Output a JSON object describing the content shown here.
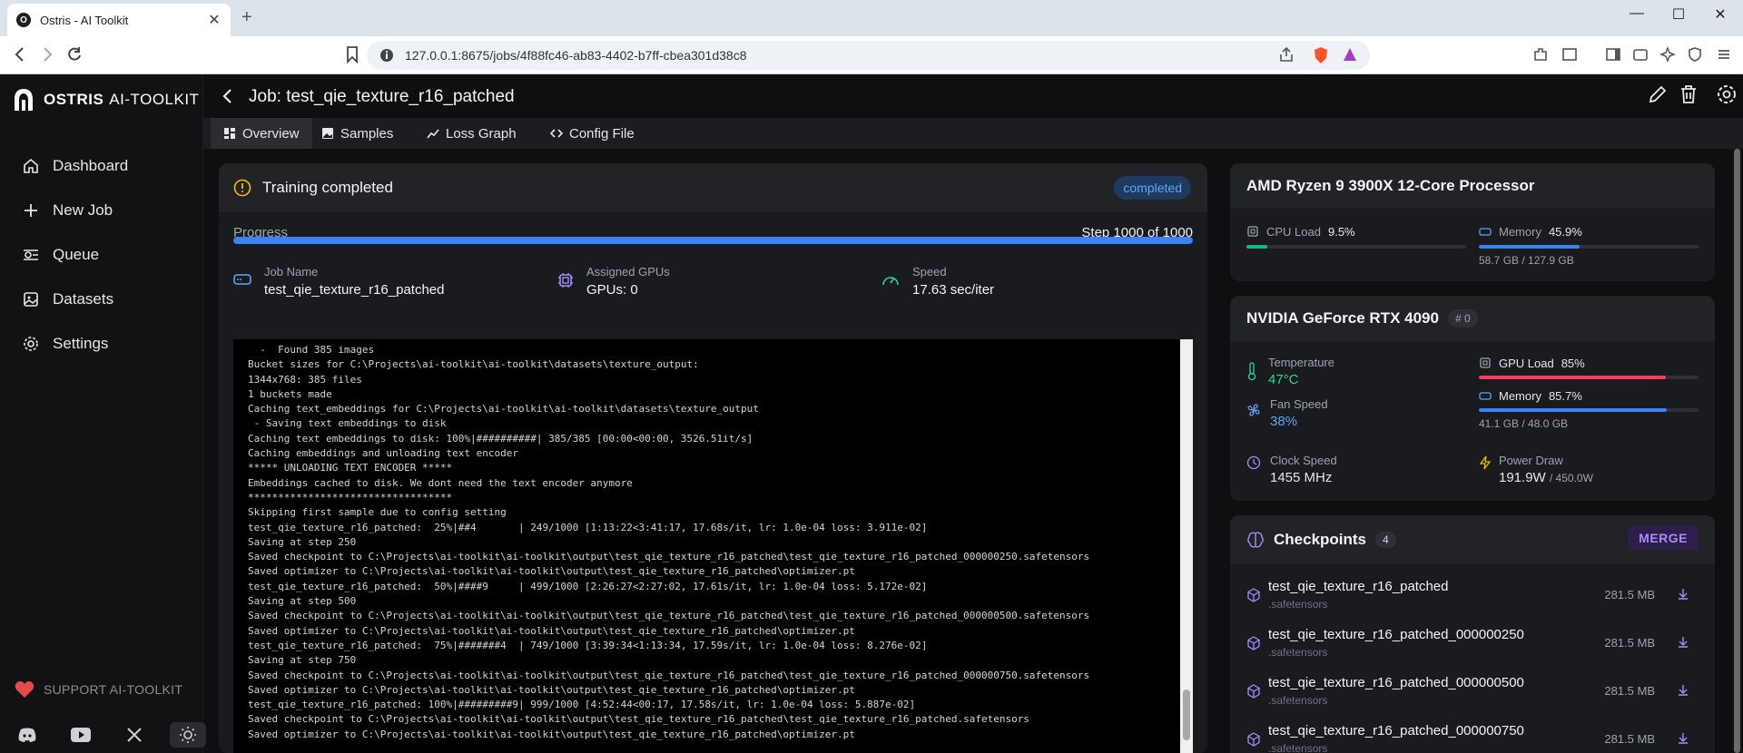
{
  "browser": {
    "tab_title": "Ostris - AI Toolkit",
    "url": "127.0.0.1:8675/jobs/4f88fc46-ab83-4402-b7ff-cbea301d38c8"
  },
  "brand": {
    "name": "OSTRIS",
    "product": "AI-TOOLKIT"
  },
  "sidebar": {
    "items": [
      {
        "label": "Dashboard",
        "icon": "home-icon"
      },
      {
        "label": "New Job",
        "icon": "plus-icon"
      },
      {
        "label": "Queue",
        "icon": "queue-icon"
      },
      {
        "label": "Datasets",
        "icon": "image-icon"
      },
      {
        "label": "Settings",
        "icon": "gear-icon"
      }
    ],
    "support_label": "SUPPORT AI-TOOLKIT"
  },
  "header": {
    "title": "Job: test_qie_texture_r16_patched"
  },
  "tabs": [
    {
      "label": "Overview",
      "active": true
    },
    {
      "label": "Samples",
      "active": false
    },
    {
      "label": "Loss Graph",
      "active": false
    },
    {
      "label": "Config File",
      "active": false
    }
  ],
  "job": {
    "status_title": "Training completed",
    "status_badge": "completed",
    "progress_label": "Progress",
    "progress_step": "Step 1000 of 1000",
    "progress_fraction": 1.0,
    "stats": [
      {
        "label": "Job Name",
        "value": "test_qie_texture_r16_patched"
      },
      {
        "label": "Assigned GPUs",
        "value": "GPUs: 0"
      },
      {
        "label": "Speed",
        "value": "17.63 sec/iter"
      }
    ],
    "log_lines": [
      "  -  Found 385 images",
      "Bucket sizes for C:\\Projects\\ai-toolkit\\ai-toolkit\\datasets\\texture_output:",
      "1344x768: 385 files",
      "1 buckets made",
      "Caching text_embeddings for C:\\Projects\\ai-toolkit\\ai-toolkit\\datasets\\texture_output",
      " - Saving text embeddings to disk",
      "Caching text embeddings to disk: 100%|##########| 385/385 [00:00<00:00, 3526.51it/s]",
      "Caching embeddings and unloading text encoder",
      "***** UNLOADING TEXT ENCODER *****",
      "Embeddings cached to disk. We dont need the text encoder anymore",
      "**********************************",
      "Skipping first sample due to config setting",
      "test_qie_texture_r16_patched:  25%|##4       | 249/1000 [1:13:22<3:41:17, 17.68s/it, lr: 1.0e-04 loss: 3.911e-02]",
      "Saving at step 250",
      "Saved checkpoint to C:\\Projects\\ai-toolkit\\ai-toolkit\\output\\test_qie_texture_r16_patched\\test_qie_texture_r16_patched_000000250.safetensors",
      "Saved optimizer to C:\\Projects\\ai-toolkit\\ai-toolkit\\output\\test_qie_texture_r16_patched\\optimizer.pt",
      "test_qie_texture_r16_patched:  50%|####9     | 499/1000 [2:26:27<2:27:02, 17.61s/it, lr: 1.0e-04 loss: 5.172e-02]",
      "Saving at step 500",
      "Saved checkpoint to C:\\Projects\\ai-toolkit\\ai-toolkit\\output\\test_qie_texture_r16_patched\\test_qie_texture_r16_patched_000000500.safetensors",
      "Saved optimizer to C:\\Projects\\ai-toolkit\\ai-toolkit\\output\\test_qie_texture_r16_patched\\optimizer.pt",
      "test_qie_texture_r16_patched:  75%|#######4  | 749/1000 [3:39:34<1:13:34, 17.59s/it, lr: 1.0e-04 loss: 8.276e-02]",
      "Saving at step 750",
      "Saved checkpoint to C:\\Projects\\ai-toolkit\\ai-toolkit\\output\\test_qie_texture_r16_patched\\test_qie_texture_r16_patched_000000750.safetensors",
      "Saved optimizer to C:\\Projects\\ai-toolkit\\ai-toolkit\\output\\test_qie_texture_r16_patched\\optimizer.pt",
      "test_qie_texture_r16_patched: 100%|#########9| 999/1000 [4:52:44<00:17, 17.58s/it, lr: 1.0e-04 loss: 5.887e-02]",
      "Saved checkpoint to C:\\Projects\\ai-toolkit\\ai-toolkit\\output\\test_qie_texture_r16_patched\\test_qie_texture_r16_patched.safetensors",
      "Saved optimizer to C:\\Projects\\ai-toolkit\\ai-toolkit\\output\\test_qie_texture_r16_patched\\optimizer.pt"
    ]
  },
  "cpu": {
    "name": "AMD Ryzen 9 3900X 12-Core Processor",
    "load_label": "CPU Load",
    "load_value": "9.5%",
    "load_fraction": 0.095,
    "mem_label": "Memory",
    "mem_value": "45.9%",
    "mem_fraction": 0.459,
    "mem_detail": "58.7 GB / 127.9 GB"
  },
  "gpu": {
    "name": "NVIDIA GeForce RTX 4090",
    "badge": "# 0",
    "temp_label": "Temperature",
    "temp_value": "47°C",
    "fan_label": "Fan Speed",
    "fan_value": "38%",
    "clock_label": "Clock Speed",
    "clock_value": "1455 MHz",
    "load_label": "GPU Load",
    "load_value": "85%",
    "load_fraction": 0.85,
    "mem_label": "Memory",
    "mem_value": "85.7%",
    "mem_fraction": 0.857,
    "mem_detail": "41.1 GB / 48.0 GB",
    "power_label": "Power Draw",
    "power_value": "191.9W",
    "power_max": "/ 450.0W"
  },
  "checkpoints": {
    "title": "Checkpoints",
    "count": "4",
    "merge_label": "MERGE",
    "items": [
      {
        "name": "test_qie_texture_r16_patched",
        "ext": ".safetensors",
        "size": "281.5 MB"
      },
      {
        "name": "test_qie_texture_r16_patched_000000250",
        "ext": ".safetensors",
        "size": "281.5 MB"
      },
      {
        "name": "test_qie_texture_r16_patched_000000500",
        "ext": ".safetensors",
        "size": "281.5 MB"
      },
      {
        "name": "test_qie_texture_r16_patched_000000750",
        "ext": ".safetensors",
        "size": "281.5 MB"
      }
    ]
  },
  "colors": {
    "accent_blue": "#3b82f6",
    "cpu_load_green": "#10b981",
    "gpu_load_red": "#f43f5e",
    "temp_green": "#34d399",
    "fan_blue": "#60a5fa",
    "checkpoint_purple": "#a78bfa"
  }
}
